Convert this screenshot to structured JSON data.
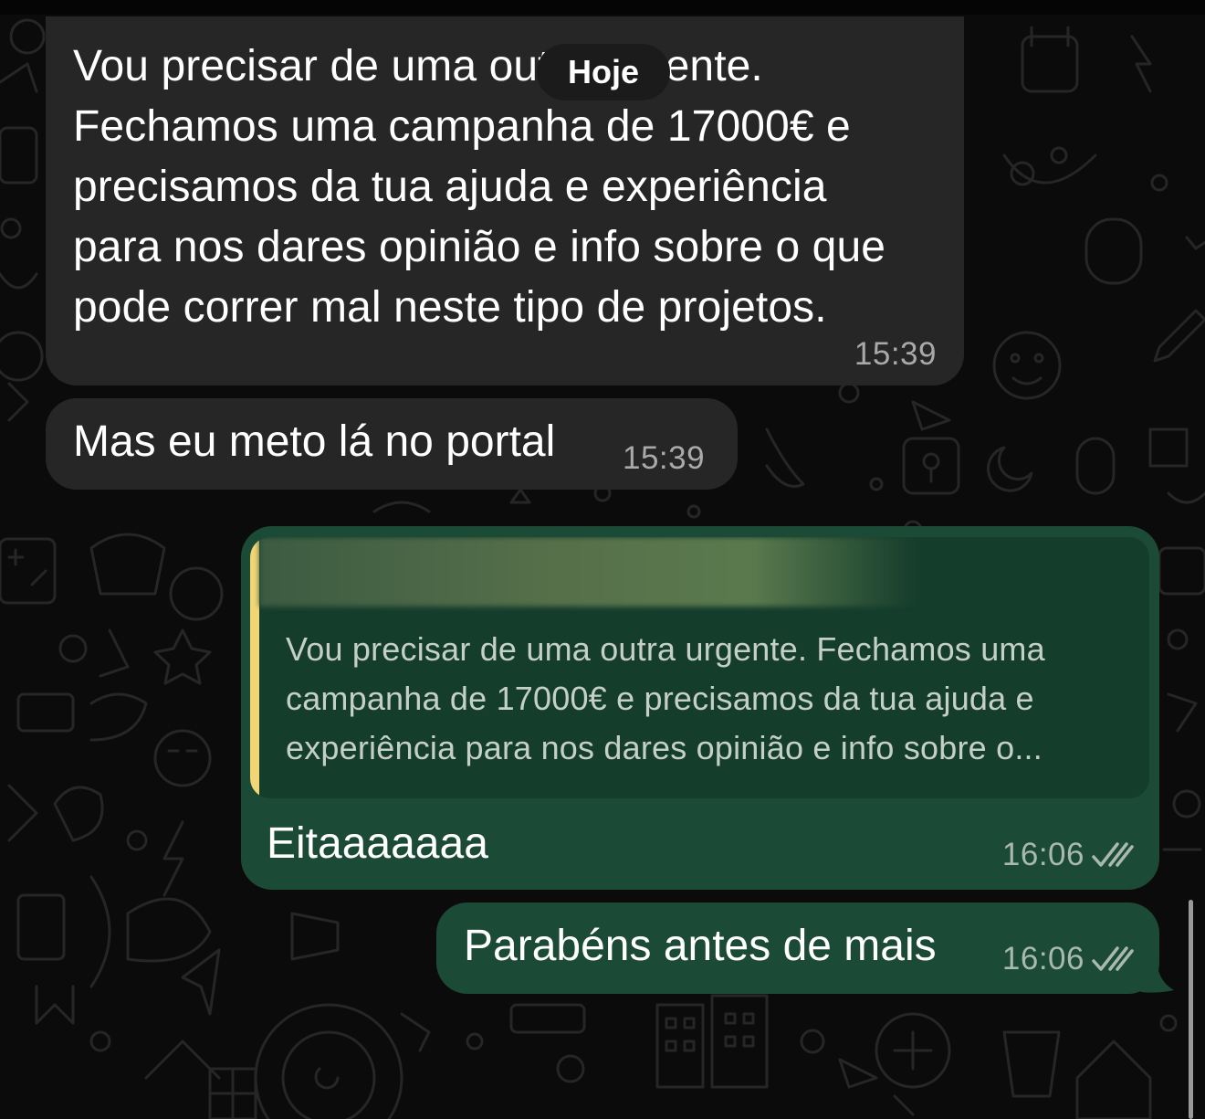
{
  "date_divider": "Hoje",
  "messages": [
    {
      "direction": "incoming",
      "text_lines": [
        "Vou precisar de uma outra urgente.",
        "Fechamos uma campanha de 17000€ e",
        "precisamos da tua ajuda e experiência",
        "para nos dares opinião e info sobre o que",
        "pode correr mal neste tipo de projetos."
      ],
      "time": "15:39"
    },
    {
      "direction": "incoming",
      "text": "Mas eu meto lá no portal",
      "time": "15:39"
    },
    {
      "direction": "outgoing",
      "quote_lines": [
        "Vou precisar de uma outra urgente. Fechamos uma",
        "campanha de 17000€ e precisamos da tua ajuda e",
        "experiência para nos dares opinião e info sobre o..."
      ],
      "text": "Eitaaaaaaa",
      "time": "16:06",
      "status_icon": "double-check-icon"
    },
    {
      "direction": "outgoing",
      "text": "Parabéns antes de mais",
      "time": "16:06",
      "status_icon": "double-check-icon"
    }
  ],
  "colors": {
    "background": "#0b0b0b",
    "incoming_bubble": "#262626",
    "outgoing_bubble": "#1b4a36",
    "quote_bar": "#f2d675",
    "quote_background": "#153d2c"
  }
}
